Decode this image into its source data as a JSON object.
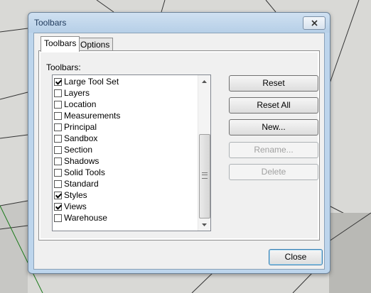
{
  "window": {
    "title": "Toolbars"
  },
  "tabs": [
    {
      "label": "Toolbars"
    },
    {
      "label": "Options"
    }
  ],
  "toolbars_label": "Toolbars:",
  "toolbars": [
    {
      "label": "Large Tool Set",
      "checked": true
    },
    {
      "label": "Layers",
      "checked": false
    },
    {
      "label": "Location",
      "checked": false
    },
    {
      "label": "Measurements",
      "checked": false
    },
    {
      "label": "Principal",
      "checked": false
    },
    {
      "label": "Sandbox",
      "checked": false
    },
    {
      "label": "Section",
      "checked": false
    },
    {
      "label": "Shadows",
      "checked": false
    },
    {
      "label": "Solid Tools",
      "checked": false
    },
    {
      "label": "Standard",
      "checked": false
    },
    {
      "label": "Styles",
      "checked": true
    },
    {
      "label": "Views",
      "checked": true
    },
    {
      "label": "Warehouse",
      "checked": false
    }
  ],
  "buttons": {
    "reset": "Reset",
    "reset_all": "Reset All",
    "new": "New...",
    "rename": "Rename...",
    "delete": "Delete",
    "close": "Close"
  },
  "colors": {
    "frame": "#bdd5ec",
    "background_viewport": "#d9d9d6"
  }
}
